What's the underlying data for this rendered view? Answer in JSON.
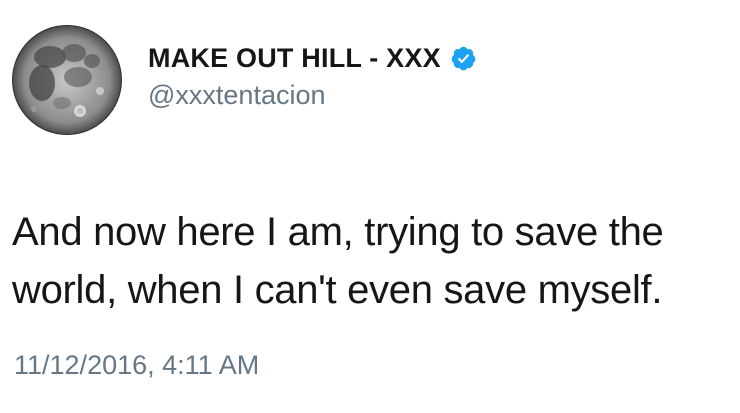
{
  "tweet": {
    "author": {
      "display_name": "MAKE OUT HILL - XXX",
      "handle": "@xxxtentacion",
      "avatar_icon": "moon-avatar",
      "verified_icon": "verified-badge-icon",
      "verified_color": "#1da1f2"
    },
    "text": "And now here I am, trying to save the\nworld, when I can't even save myself.",
    "timestamp": "11/12/2016, 4:11 AM"
  }
}
